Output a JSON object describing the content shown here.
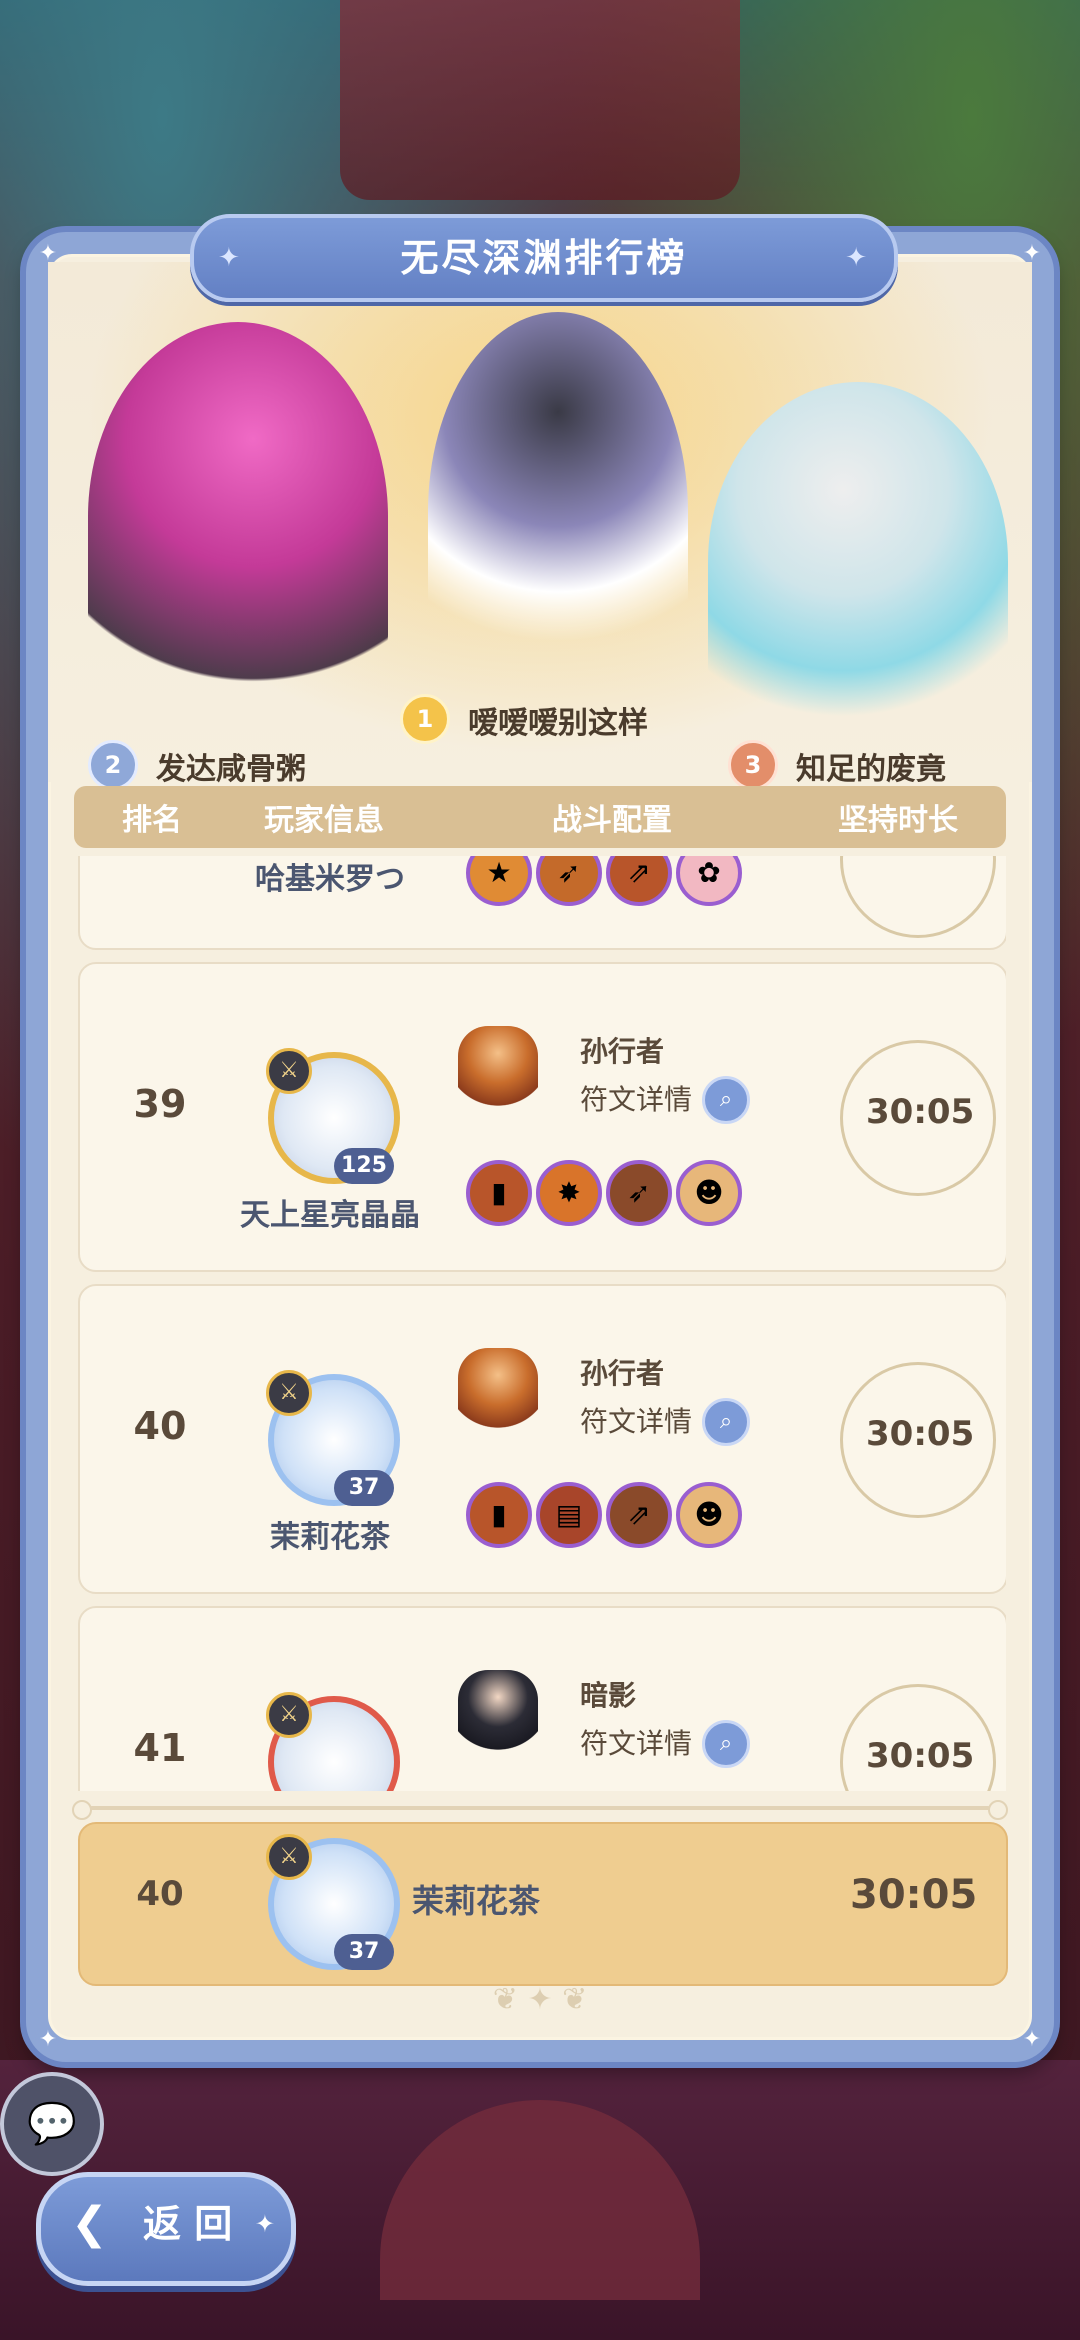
{
  "title": "无尽深渊排行榜",
  "podium": [
    {
      "rank": "1",
      "name": "嗳嗳嗳别这样"
    },
    {
      "rank": "2",
      "name": "发达咸骨粥"
    },
    {
      "rank": "3",
      "name": "知足的废竟"
    }
  ],
  "table_headers": {
    "rank": "排名",
    "player": "玩家信息",
    "loadout": "战斗配置",
    "duration": "坚持时长"
  },
  "rows": [
    {
      "rank": "",
      "name": "哈基米罗つ",
      "level": "",
      "hero": "",
      "rune_label": "",
      "time": ""
    },
    {
      "rank": "39",
      "name": "天上星亮晶晶",
      "level": "125",
      "hero": "孙行者",
      "rune_label": "符文详情",
      "time": "30:05"
    },
    {
      "rank": "40",
      "name": "茉莉花茶",
      "level": "37",
      "hero": "孙行者",
      "rune_label": "符文详情",
      "time": "30:05"
    },
    {
      "rank": "41",
      "name": "",
      "level": "",
      "hero": "暗影",
      "rune_label": "符文详情",
      "time": "30:05"
    }
  ],
  "my_row": {
    "rank": "40",
    "name": "茉莉花茶",
    "level": "37",
    "time": "30:05"
  },
  "back_label": "返 回",
  "icons": {
    "chat": "chat-bubbles-icon",
    "back": "back-arrow-icon",
    "search": "magnifier-icon",
    "moon": "crescent-moon-icon"
  },
  "colors": {
    "panel": "#8ea6d6",
    "highlight_row": "#efcd90",
    "header": "#d9bf94"
  }
}
